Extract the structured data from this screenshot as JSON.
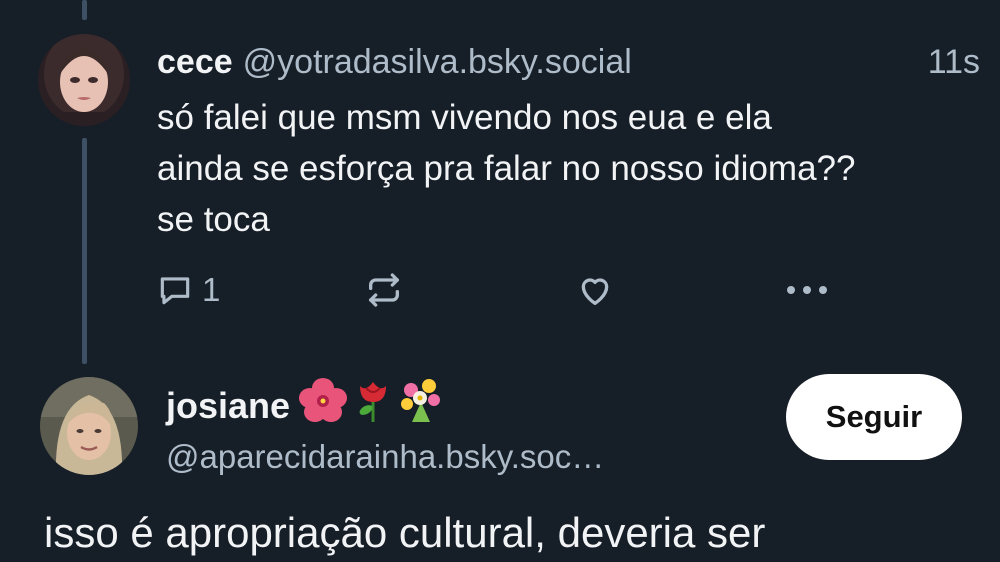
{
  "post1": {
    "author_name": "cece",
    "author_handle": "@yotradasilva.bsky.social",
    "time": "11s",
    "text_lines": [
      "só falei que msm vivendo nos eua e ela",
      "ainda se esforça pra falar no nosso idioma??",
      "se toca"
    ],
    "reply_count": "1",
    "icons": [
      "reply-icon",
      "repost-icon",
      "like-icon",
      "more-icon"
    ]
  },
  "post2": {
    "author_name": "josiane",
    "author_handle": "@aparecidarainha.bsky.soc…",
    "name_emojis": [
      "hibiscus-emoji",
      "rose-emoji",
      "bouquet-emoji"
    ],
    "follow_label": "Seguir",
    "text": "isso é apropriação cultural, deveria ser"
  },
  "colors": {
    "background": "#161e27",
    "text": "#f1f3f5",
    "muted": "#aebbc9",
    "thread_line": "#3e5064",
    "follow_button_bg": "#ffffff"
  }
}
